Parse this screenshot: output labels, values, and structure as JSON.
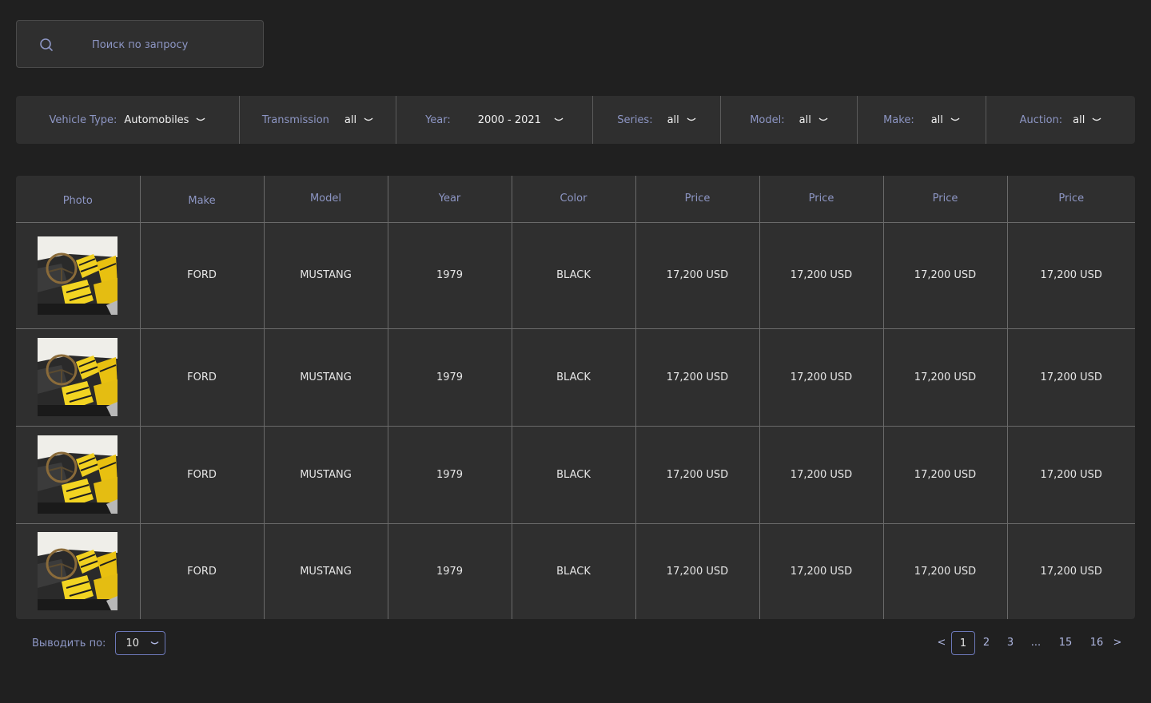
{
  "search": {
    "placeholder": "Поиск по запросу"
  },
  "filters": [
    {
      "label": "Vehicle Type:",
      "value": "Automobiles"
    },
    {
      "label": "Transmission",
      "value": "all"
    },
    {
      "label": "Year:",
      "value": "2000 - 2021"
    },
    {
      "label": "Series:",
      "value": "all"
    },
    {
      "label": "Model:",
      "value": "all"
    },
    {
      "label": "Make:",
      "value": "all"
    },
    {
      "label": "Auction:",
      "value": "all"
    }
  ],
  "table": {
    "headers": [
      "Photo",
      "Make",
      "Model",
      "Year",
      "Color",
      "Price",
      "Price",
      "Price",
      "Price"
    ],
    "rows": [
      {
        "make": "FORD",
        "model": "MUSTANG",
        "year": "1979",
        "color": "BLACK",
        "prices": [
          "17,200 USD",
          "17,200 USD",
          "17,200 USD",
          "17,200 USD"
        ]
      },
      {
        "make": "FORD",
        "model": "MUSTANG",
        "year": "1979",
        "color": "BLACK",
        "prices": [
          "17,200 USD",
          "17,200 USD",
          "17,200 USD",
          "17,200 USD"
        ]
      },
      {
        "make": "FORD",
        "model": "MUSTANG",
        "year": "1979",
        "color": "BLACK",
        "prices": [
          "17,200 USD",
          "17,200 USD",
          "17,200 USD",
          "17,200 USD"
        ]
      },
      {
        "make": "FORD",
        "model": "MUSTANG",
        "year": "1979",
        "color": "BLACK",
        "prices": [
          "17,200 USD",
          "17,200 USD",
          "17,200 USD",
          "17,200 USD"
        ]
      }
    ]
  },
  "pagination": {
    "per_page_label": "Выводить по:",
    "per_page_value": "10",
    "prev": "<",
    "next": ">",
    "pages": [
      "1",
      "2",
      "3",
      "...",
      "15",
      "16"
    ],
    "current": "1"
  },
  "icons": {
    "search": "search-icon",
    "chevron": "chevron-down-icon",
    "photo": "car-interior-photo"
  },
  "colors": {
    "background": "#202020",
    "panel": "#2f2f2f",
    "label": "#8d96c4",
    "accent_border": "#6c78b8",
    "text": "#e6e6e6"
  }
}
